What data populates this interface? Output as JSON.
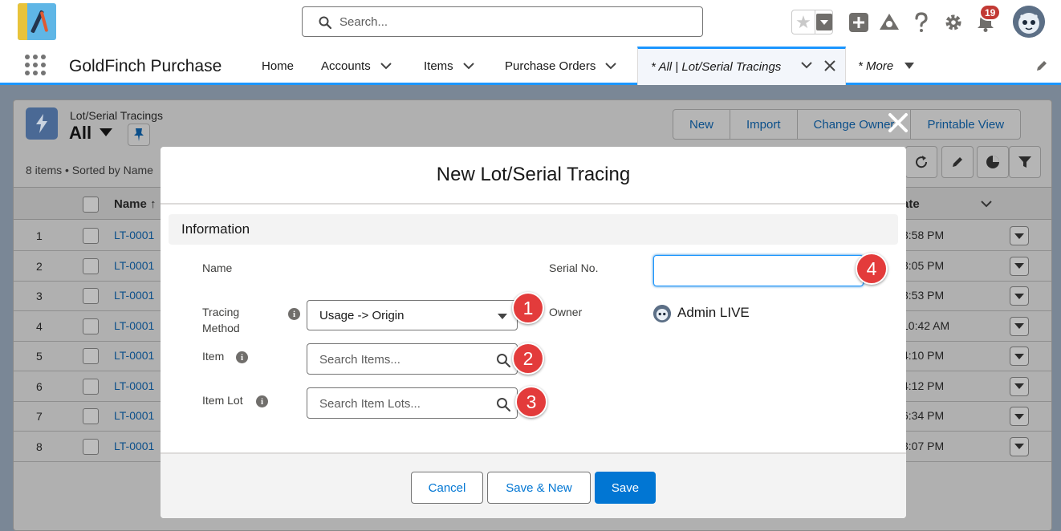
{
  "header": {
    "search_placeholder": "Search...",
    "notification_count": "19"
  },
  "nav": {
    "app_name": "GoldFinch Purchase",
    "items": [
      {
        "label": "Home"
      },
      {
        "label": "Accounts"
      },
      {
        "label": "Items"
      },
      {
        "label": "Purchase Orders"
      }
    ],
    "active_tab": "* All | Lot/Serial Tracings",
    "more": "* More"
  },
  "list_view": {
    "object_label": "Lot/Serial Tracings",
    "view_name": "All",
    "meta": "8 items • Sorted by Name",
    "actions": [
      "New",
      "Import",
      "Change Owner",
      "Printable View"
    ],
    "columns": {
      "name": "Name",
      "date": "ate"
    },
    "rows": [
      {
        "num": "1",
        "name": "LT-0001",
        "date": "3:58 PM"
      },
      {
        "num": "2",
        "name": "LT-0001",
        "date": "3:05 PM"
      },
      {
        "num": "3",
        "name": "LT-0001",
        "date": "3:53 PM"
      },
      {
        "num": "4",
        "name": "LT-0001",
        "date": "10:42 AM"
      },
      {
        "num": "5",
        "name": "LT-0001",
        "date": "4:10 PM"
      },
      {
        "num": "6",
        "name": "LT-0001",
        "date": "4:12 PM"
      },
      {
        "num": "7",
        "name": "LT-0001",
        "date": "6:34 PM"
      },
      {
        "num": "8",
        "name": "LT-0001",
        "date": "3:07 PM"
      }
    ]
  },
  "modal": {
    "title": "New Lot/Serial Tracing",
    "section": "Information",
    "fields": {
      "name_label": "Name",
      "tracing_method_label_1": "Tracing",
      "tracing_method_label_2": "Method",
      "tracing_method_value": "Usage -> Origin",
      "item_label": "Item",
      "item_placeholder": "Search Items...",
      "item_lot_label": "Item Lot",
      "item_lot_placeholder": "Search Item Lots...",
      "serial_label": "Serial No.",
      "serial_value": "",
      "owner_label": "Owner",
      "owner_value": "Admin LIVE"
    },
    "callouts": [
      "1",
      "2",
      "3",
      "4"
    ],
    "buttons": {
      "cancel": "Cancel",
      "save_new": "Save & New",
      "save": "Save"
    }
  },
  "colors": {
    "brand": "#0176d3",
    "callout": "#e33b3b",
    "active_tab_border": "#1b96ff"
  }
}
